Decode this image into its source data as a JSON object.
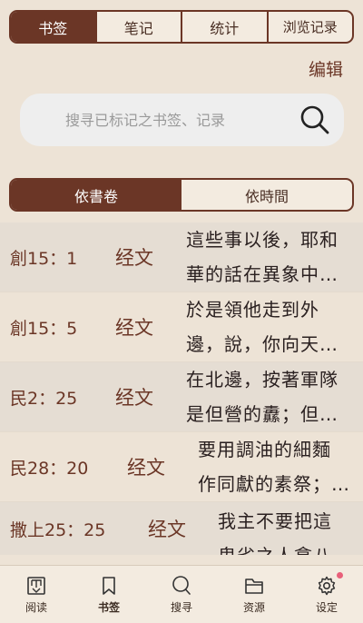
{
  "top_tabs": [
    "书签",
    "笔记",
    "统计",
    "浏览记录"
  ],
  "edit_label": "编辑",
  "search": {
    "placeholder": "搜寻已标记之书签、记录"
  },
  "sort_tabs": [
    "依書卷",
    "依時間"
  ],
  "bookmarks": [
    {
      "ref": "創15：1",
      "kind": "经文",
      "line1": "這些事以後，耶和",
      "line2": "華的話在異象中…"
    },
    {
      "ref": "創15：5",
      "kind": "经文",
      "line1": "於是領他走到外",
      "line2": "邊，說，你向天…"
    },
    {
      "ref": "民2：25",
      "kind": "经文",
      "line1": "在北邊，按著軍隊",
      "line2": "是但營的纛；但…"
    },
    {
      "ref": "民28：20",
      "kind": "经文",
      "line1": "要用調油的細麵",
      "line2": "作同獻的素祭；…"
    },
    {
      "ref": "撒上25：25",
      "kind": "经文",
      "line1": "我主不要把這",
      "line2": "卑劣之人拿八…"
    }
  ],
  "bottom_nav": [
    "阅读",
    "书签",
    "搜寻",
    "资源",
    "设定"
  ],
  "colors": {
    "accent": "#6b3626",
    "background": "#ede3d6"
  }
}
